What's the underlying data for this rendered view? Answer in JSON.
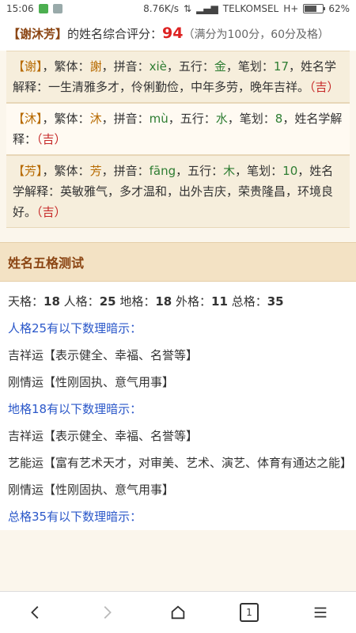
{
  "status_bar": {
    "time": "15:06",
    "speed": "8.76K/s",
    "network_arrows": "⇅",
    "signal": "▂▄▆",
    "carrier": "TELKOMSEL",
    "type": "H+",
    "battery_text": "62%",
    "battery_level": 0.62
  },
  "summary": {
    "name_bracket": "【谢沐芳】",
    "text_before": "的姓名综合评分：",
    "score": "94",
    "note": "（满分为100分，60分及格）"
  },
  "chars": [
    {
      "bracket_open": "【",
      "char": "谢",
      "bracket_close": "】",
      "fanti_label": "，繁体：",
      "fanti": "謝",
      "pinyin_label": "，拼音：",
      "pinyin": "xiè",
      "wuxing_label": "，五行：",
      "wuxing": "金",
      "bihua_label": "，笔划：",
      "bihua": "17",
      "jieshi_label": "，姓名学解释：",
      "jieshi": "一生清雅多才，伶俐勤俭，中年多劳，晚年吉祥。",
      "luck": "（吉）"
    },
    {
      "bracket_open": "【",
      "char": "沐",
      "bracket_close": "】",
      "fanti_label": "，繁体：",
      "fanti": "沐",
      "pinyin_label": "，拼音：",
      "pinyin": "mù",
      "wuxing_label": "，五行：",
      "wuxing": "水",
      "bihua_label": "，笔划：",
      "bihua": "8",
      "jieshi_label": "，姓名学解释：",
      "jieshi": "",
      "luck": "（吉）"
    },
    {
      "bracket_open": "【",
      "char": "芳",
      "bracket_close": "】",
      "fanti_label": "，繁体：",
      "fanti": "芳",
      "pinyin_label": "，拼音：",
      "pinyin": "fāng",
      "wuxing_label": "，五行：",
      "wuxing": "木",
      "bihua_label": "，笔划：",
      "bihua": "10",
      "jieshi_label": "，姓名学解释：",
      "jieshi": "英敏雅气，多才温和，出外吉庆，荣贵隆昌，环境良好。",
      "luck": "（吉）"
    }
  ],
  "section": {
    "title": "姓名五格测试",
    "wuge": {
      "tian_label": "天格：",
      "tian": "18",
      "ren_label": "人格：",
      "ren": "25",
      "di_label": "地格：",
      "di": "18",
      "wai_label": "外格：",
      "wai": "11",
      "zong_label": "总格：",
      "zong": "35"
    },
    "rows": [
      {
        "type": "header",
        "text": "人格25有以下数理暗示："
      },
      {
        "type": "text",
        "text": "吉祥运【表示健全、幸福、名誉等】"
      },
      {
        "type": "text",
        "text": "刚情运【性刚固执、意气用事】"
      },
      {
        "type": "header",
        "text": "地格18有以下数理暗示："
      },
      {
        "type": "text",
        "text": "吉祥运【表示健全、幸福、名誉等】"
      },
      {
        "type": "text",
        "text": "艺能运【富有艺术天才，对审美、艺术、演艺、体育有通达之能】"
      },
      {
        "type": "text",
        "text": "刚情运【性刚固执、意气用事】"
      },
      {
        "type": "header",
        "text": "总格35有以下数理暗示："
      }
    ]
  },
  "bottom_nav": {
    "back_icon": "chevron-left-icon",
    "forward_icon": "chevron-right-icon",
    "home_icon": "home-icon",
    "tabs_count": "1",
    "menu_icon": "menu-icon"
  }
}
